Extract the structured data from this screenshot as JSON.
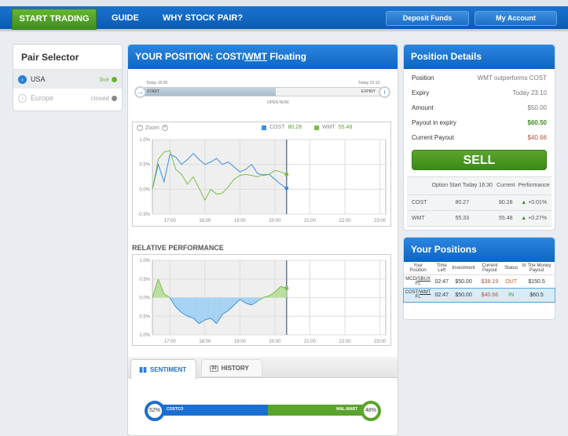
{
  "nav": {
    "start_trading": "START TRADING",
    "guide": "GUIDE",
    "why": "WHY STOCK PAIR?",
    "deposit": "Deposit Funds",
    "account": "My Account"
  },
  "pair_selector": {
    "title": "Pair Selector",
    "items": [
      {
        "label": "USA",
        "status": "live"
      },
      {
        "label": "Europe",
        "status": "closed"
      }
    ]
  },
  "position": {
    "title_prefix": "YOUR POSITION: COST/",
    "title_link": "WMT",
    "title_suffix": " Floating",
    "timeline": {
      "start_time": "Today 16:30",
      "end_time": "Today 23:10",
      "start": "START",
      "expiry": "EXPIRY",
      "now": "OPEN NOW",
      "progress": 0.56
    }
  },
  "chart_data": [
    {
      "type": "line",
      "title": "",
      "zoom_label": "Zoom",
      "legend": [
        {
          "name": "COST",
          "value": "80.28",
          "color": "#3b8fe0"
        },
        {
          "name": "WMT",
          "value": "55.48",
          "color": "#7cbf45"
        }
      ],
      "y_ticks": [
        "1.0%",
        "0.5%",
        "0.0%",
        "-0.5%"
      ],
      "ylim": [
        -0.5,
        1.0
      ],
      "x_ticks": [
        "17:00",
        "18:00",
        "19:00",
        "20:00",
        "21:00",
        "22:00",
        "23:00"
      ],
      "xlim_minutes": [
        990,
        1390
      ],
      "now_minutes": 1220,
      "x_start_minutes": 990,
      "step_minutes": 10,
      "series": [
        {
          "name": "COST",
          "values": [
            0,
            0.5,
            0.15,
            0.7,
            0.65,
            0.5,
            0.6,
            0.72,
            0.6,
            0.5,
            0.55,
            0.62,
            0.5,
            0.55,
            0.45,
            0.35,
            0.4,
            0.5,
            0.32,
            0.28,
            0.3,
            0.2,
            0.1,
            0.02
          ]
        },
        {
          "name": "WMT",
          "values": [
            0,
            0.6,
            0.75,
            0.78,
            0.4,
            0.3,
            0.1,
            0.25,
            0.02,
            -0.22,
            0.0,
            -0.1,
            -0.08,
            0.05,
            0.2,
            0.28,
            0.3,
            0.28,
            0.25,
            0.3,
            0.3,
            0.38,
            0.35,
            0.3
          ]
        }
      ]
    },
    {
      "type": "area",
      "title": "RELATIVE PERFORMANCE",
      "y_ticks": [
        "1.0%",
        "0.5%",
        "0.0%",
        "0.5%",
        "1.0%"
      ],
      "ylim": [
        -1.0,
        1.0
      ],
      "x_ticks": [
        "17:00",
        "18:00",
        "19:00",
        "20:00",
        "21:00",
        "22:00",
        "23:00"
      ],
      "xlim_minutes": [
        990,
        1390
      ],
      "now_minutes": 1220,
      "x_start_minutes": 990,
      "step_minutes": 10,
      "series": [
        {
          "name": "Relative",
          "values": [
            0,
            0.5,
            0.1,
            0.0,
            -0.25,
            -0.4,
            -0.5,
            -0.55,
            -0.7,
            -0.6,
            -0.55,
            -0.7,
            -0.45,
            -0.35,
            -0.2,
            -0.05,
            -0.15,
            -0.2,
            -0.1,
            0.0,
            0.05,
            0.15,
            0.3,
            0.25
          ]
        }
      ]
    }
  ],
  "tabs": [
    {
      "label": "SENTIMENT"
    },
    {
      "label": "HISTORY",
      "icon_text": "30"
    }
  ],
  "sentiment": {
    "left_pct": "52%",
    "left_name": "COSTCO",
    "right_pct": "48%",
    "right_name": "WAL-MART",
    "left_fraction": 0.52
  },
  "details": {
    "title": "Position Details",
    "rows": [
      {
        "label": "Position",
        "value": "WMT outperforms COST"
      },
      {
        "label": "Expiry",
        "value": "Today 23:10"
      },
      {
        "label": "Amount",
        "value": "$50.00"
      },
      {
        "label": "Payout in expiry",
        "value": "$60.50"
      },
      {
        "label": "Current Payout",
        "value": "$40.66"
      }
    ],
    "sell": "SELL",
    "perf": {
      "headers": [
        "",
        "Option Start Today 16:30",
        "Current",
        "Performance"
      ],
      "rows": [
        [
          "COST",
          "80.27",
          "80.28",
          "+0.01%"
        ],
        [
          "WMT",
          "55.33",
          "55.48",
          "+0.27%"
        ]
      ]
    }
  },
  "positions": {
    "title": "Your Positions",
    "headers": [
      "Your Position",
      "Time Left",
      "Investment",
      "Current Payout",
      "Status",
      "In The Money Payout"
    ],
    "rows": [
      {
        "pair_a": "MCD/",
        "pair_b": "SBUX",
        "fl": "FL",
        "time": "02:47",
        "inv": "$50.00",
        "payout": "$38.19",
        "status": "OUT",
        "itm": "$150.5"
      },
      {
        "pair_a": "COST/",
        "pair_b": "WMT",
        "fl": "FL",
        "time": "02:47",
        "inv": "$50.00",
        "payout": "$40.66",
        "status": "IN",
        "itm": "$60.5"
      }
    ]
  }
}
